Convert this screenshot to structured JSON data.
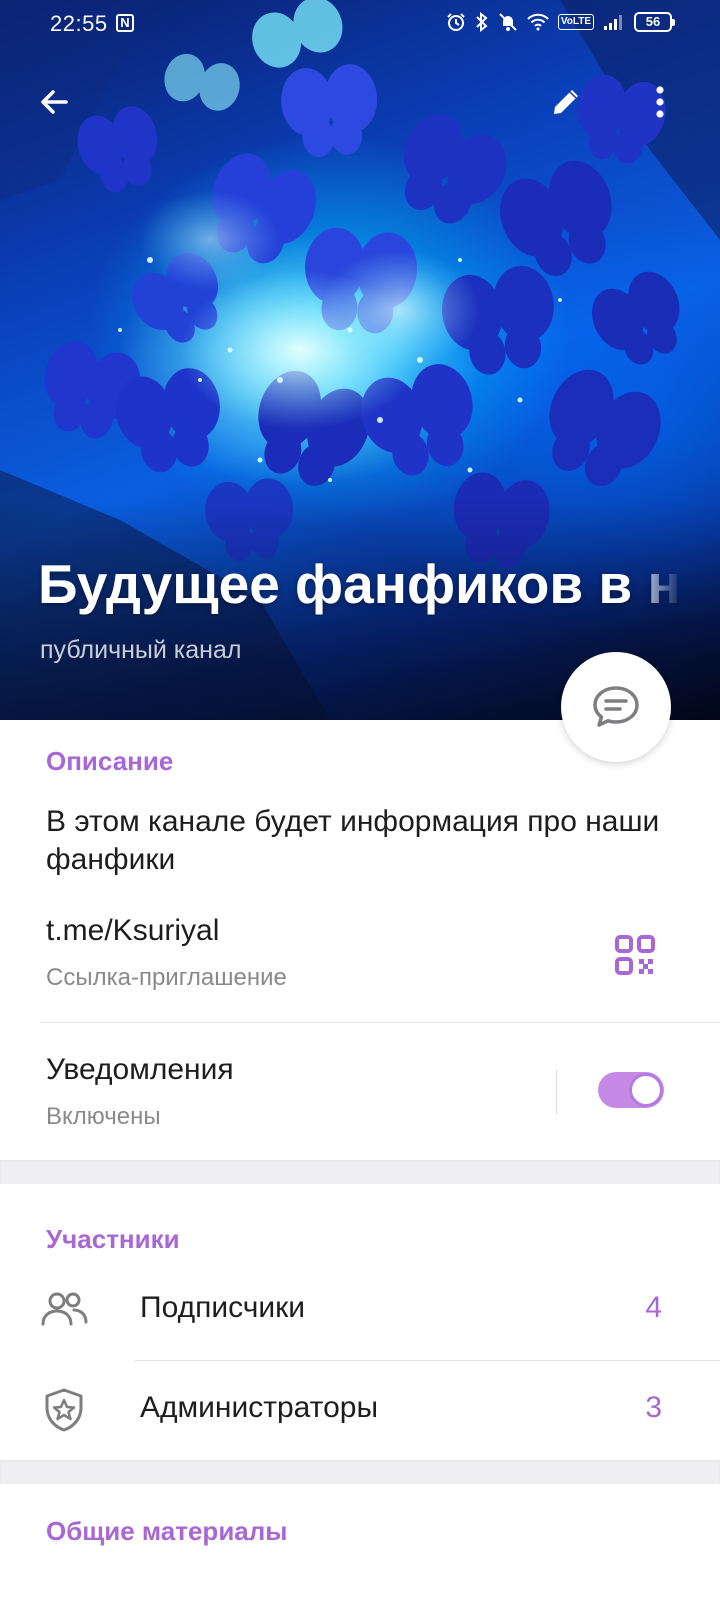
{
  "status_bar": {
    "time": "22:55",
    "nfc": "N",
    "volte": "VoLTE",
    "battery": "56"
  },
  "header": {
    "title": "Будущее фанфиков в н",
    "subtitle": "публичный канал",
    "icons": {
      "back": "back-arrow-icon",
      "edit": "pencil-icon",
      "menu": "more-vertical-icon",
      "fab": "chat-bubble-icon"
    }
  },
  "info": {
    "section_title": "Описание",
    "description": "В этом канале будет информация про наши фанфики",
    "link": "t.me/Ksuriyal",
    "link_caption": "Ссылка-приглашение",
    "notifications_label": "Уведомления",
    "notifications_status": "Включены",
    "notifications_enabled": true
  },
  "members": {
    "section_title": "Участники",
    "items": [
      {
        "label": "Подписчики",
        "count": "4",
        "icon": "people-icon"
      },
      {
        "label": "Администраторы",
        "count": "3",
        "icon": "shield-star-icon"
      }
    ]
  },
  "media": {
    "section_title": "Общие материалы"
  },
  "colors": {
    "accent": "#a867d4",
    "toggle_on": "#c48ae6",
    "text_primary": "#1d1d1d",
    "text_secondary": "#8a8a8e",
    "section_gap": "#efeff1"
  }
}
